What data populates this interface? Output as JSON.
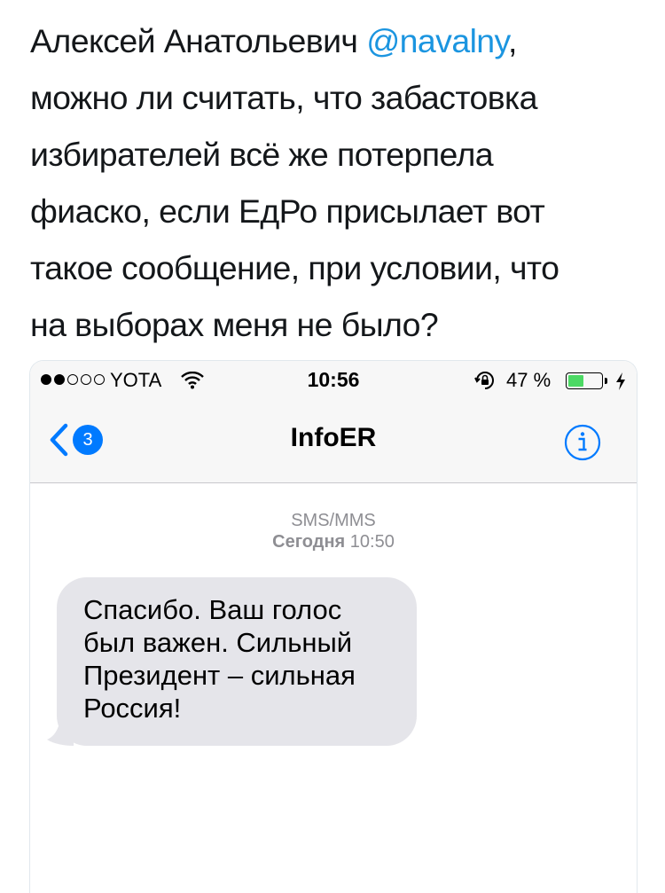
{
  "tweet": {
    "lines": [
      "Алексей Анатольевич ",
      "можно ли считать, что забастовка",
      "избирателей всё же потерпела",
      "фиаско, если ЕдРо присылает вот",
      "такое сообщение, при условии, что",
      "на выборах меня не было?"
    ],
    "mention": "@navalny",
    "mention_suffix": ","
  },
  "phone": {
    "status_bar": {
      "signal_dots_filled": 2,
      "signal_dots_total": 5,
      "carrier": "YOTA",
      "time": "10:56",
      "battery_percent": "47 %",
      "battery_level": 0.47,
      "icons": [
        "wifi-icon",
        "rotation-lock-icon",
        "charging-bolt-icon"
      ]
    },
    "nav": {
      "back_count": "3",
      "title": "InfoER",
      "info_icon": "info-icon"
    },
    "conversation": {
      "service": "SMS/MMS",
      "day": "Сегодня",
      "time": "10:50",
      "message_lines": [
        "Спасибо. Ваш голос",
        "был важен. Сильный",
        "Президент – сильная",
        "Россия!"
      ]
    }
  },
  "colors": {
    "mention": "#1b95e0",
    "ios_blue": "#007aff",
    "bubble": "#e5e5ea",
    "battery_fill": "#4cd964"
  }
}
